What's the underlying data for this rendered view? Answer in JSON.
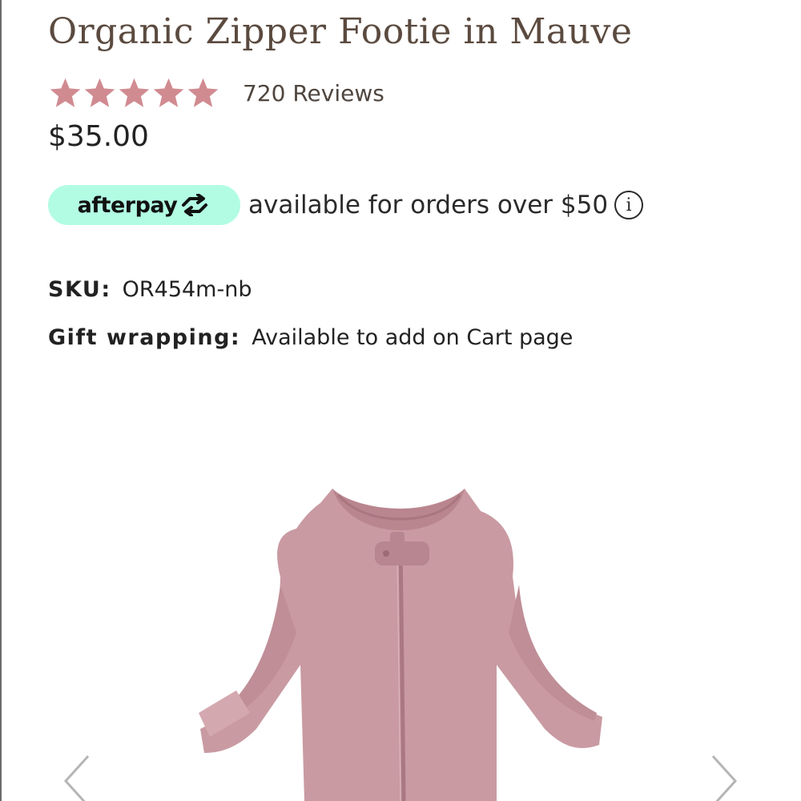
{
  "product": {
    "title": "Organic Zipper Footie in Mauve",
    "rating": 5,
    "rating_max": 5,
    "reviews_label": "720 Reviews",
    "price": "$35.00"
  },
  "afterpay": {
    "logo_text": "afterpay",
    "message": "available for orders over $50",
    "info_icon_glyph": "i"
  },
  "details": {
    "sku_label": "SKU:",
    "sku_value": "OR454m-nb",
    "gift_label": "Gift wrapping:",
    "gift_value": "Available to add on Cart page"
  },
  "gallery": {
    "prev_icon": "chevron-left-icon",
    "next_icon": "chevron-right-icon"
  },
  "colors": {
    "star": "#d08b91",
    "title": "#5b4a3f",
    "afterpay_pill": "#b2fce4",
    "garment": "#c99aa2"
  }
}
